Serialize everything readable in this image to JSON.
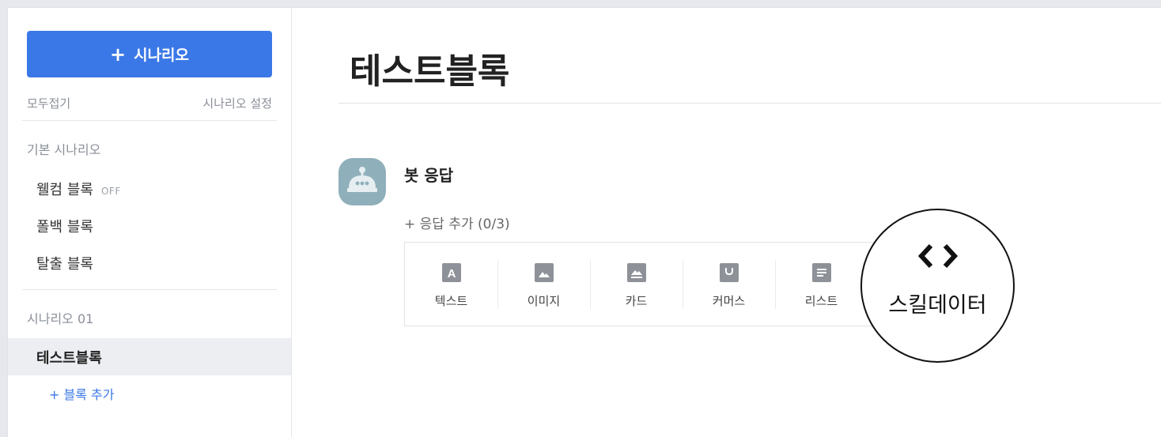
{
  "sidebar": {
    "add_button": {
      "icon": "plus-icon",
      "label": "시나리오"
    },
    "collapse_all": "모두접기",
    "scenario_settings": "시나리오 설정",
    "default_group": {
      "title": "기본 시나리오",
      "items": [
        {
          "label": "웰컴 블록",
          "tag": "OFF"
        },
        {
          "label": "폴백 블록"
        },
        {
          "label": "탈출 블록"
        }
      ]
    },
    "scenario_group": {
      "title": "시나리오 01",
      "active_item": "테스트블록",
      "add_block": "+ 블록 추가"
    }
  },
  "main": {
    "title": "테스트블록",
    "bot_response": {
      "avatar_icon": "robot-icon",
      "label": "봇 응답",
      "add_response": "+ 응답 추가 (0/3)"
    },
    "response_types": [
      {
        "icon": "text-icon",
        "label": "텍스트"
      },
      {
        "icon": "image-icon",
        "label": "이미지"
      },
      {
        "icon": "card-icon",
        "label": "카드"
      },
      {
        "icon": "commerce-icon",
        "label": "커머스"
      },
      {
        "icon": "list-icon",
        "label": "리스트"
      }
    ],
    "callout": {
      "icon": "code-brackets-icon",
      "label": "스킬데이터"
    }
  },
  "colors": {
    "accent": "#3b78e7",
    "avatar": "#8fb0bb",
    "icon_gray": "#8e9298"
  }
}
